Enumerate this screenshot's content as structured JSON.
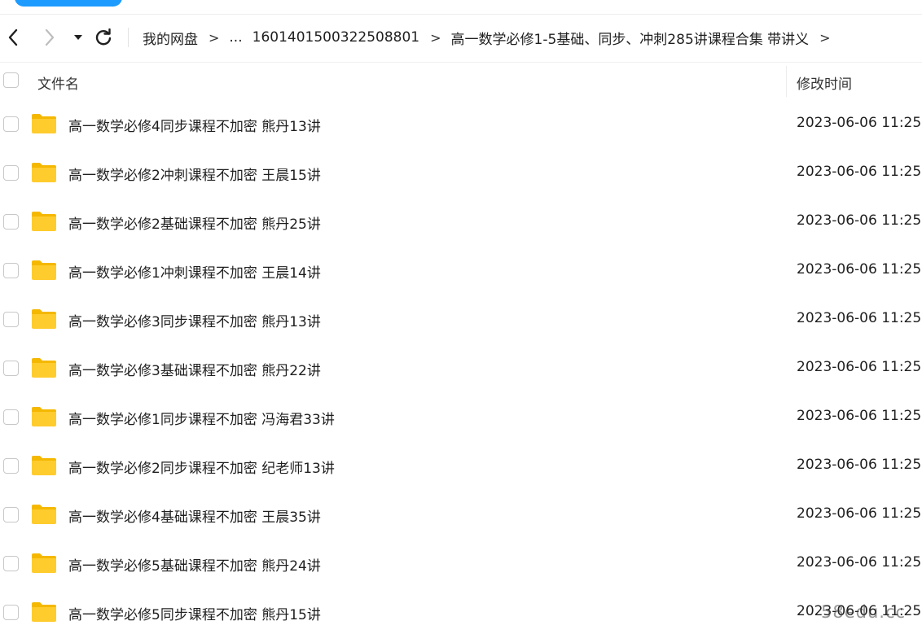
{
  "nav": {
    "back_label": "Back",
    "forward_label": "Forward"
  },
  "breadcrumb": {
    "root": "我的网盘",
    "ellipsis": "...",
    "folder_id": "1601401500322508801",
    "current": "高一数学必修1-5基础、同步、冲刺285讲课程合集 带讲义",
    "separator": ">"
  },
  "table": {
    "headers": {
      "name": "文件名",
      "modified": "修改时间"
    },
    "rows": [
      {
        "name": "高一数学必修4同步课程不加密 熊丹13讲",
        "modified": "2023-06-06 11:25"
      },
      {
        "name": "高一数学必修2冲刺课程不加密 王晨15讲",
        "modified": "2023-06-06 11:25"
      },
      {
        "name": "高一数学必修2基础课程不加密 熊丹25讲",
        "modified": "2023-06-06 11:25"
      },
      {
        "name": "高一数学必修1冲刺课程不加密 王晨14讲",
        "modified": "2023-06-06 11:25"
      },
      {
        "name": "高一数学必修3同步课程不加密 熊丹13讲",
        "modified": "2023-06-06 11:25"
      },
      {
        "name": "高一数学必修3基础课程不加密 熊丹22讲",
        "modified": "2023-06-06 11:25"
      },
      {
        "name": "高一数学必修1同步课程不加密 冯海君33讲",
        "modified": "2023-06-06 11:25"
      },
      {
        "name": "高一数学必修2同步课程不加密 纪老师13讲",
        "modified": "2023-06-06 11:25"
      },
      {
        "name": "高一数学必修4基础课程不加密 王晨35讲",
        "modified": "2023-06-06 11:25"
      },
      {
        "name": "高一数学必修5基础课程不加密 熊丹24讲",
        "modified": "2023-06-06 11:25"
      },
      {
        "name": "高一数学必修5同步课程不加密 熊丹15讲",
        "modified": "2023-06-06 11:25"
      }
    ]
  },
  "icons": {
    "back": "chevron-left-icon",
    "forward": "chevron-right-icon",
    "history": "caret-down-icon",
    "refresh": "refresh-icon",
    "folder": "folder-icon"
  },
  "colors": {
    "accent": "#1e9bff",
    "folder": "#ffcc2e",
    "folder_back": "#f5b800",
    "text": "#1f1f1f",
    "forward_disabled": "#bdbdbd"
  },
  "watermark": "58edu.cc"
}
